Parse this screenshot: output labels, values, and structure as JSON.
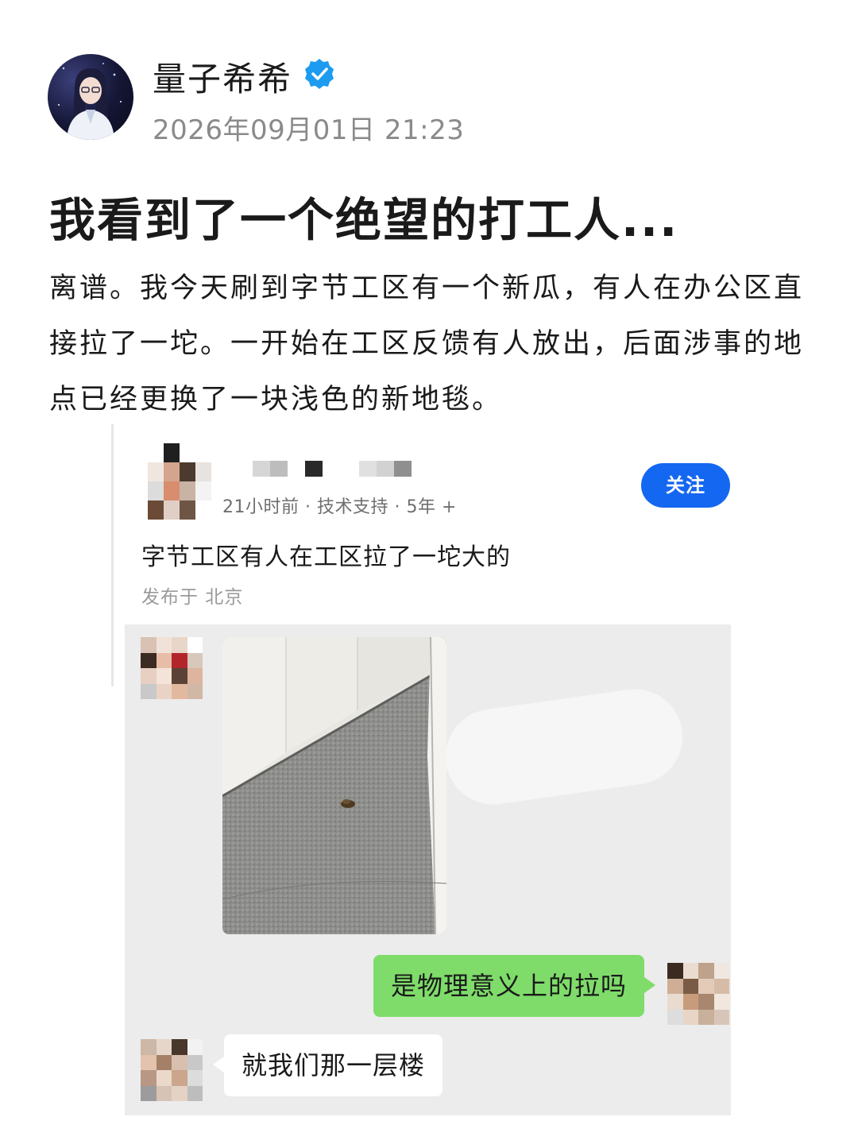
{
  "author": {
    "name": "量子希希",
    "verified": true,
    "timestamp": "2026年09月01日  21:23"
  },
  "post": {
    "title": "我看到了一个绝望的打工人...",
    "body": "离谱。我今天刷到字节工区有一个新瓜，有人在办公区直接拉了一坨。一开始在工区反馈有人放出，后面涉事的地点已经更换了一块浅色的新地毯。"
  },
  "embedded": {
    "meta": "21小时前 · 技术支持 · 5年 +",
    "follow_label": "关注",
    "title": "字节工区有人在工区拉了一坨大的",
    "location": "发布于 北京",
    "chat": {
      "messages": [
        {
          "side": "left",
          "type": "image"
        },
        {
          "side": "right",
          "text": "是物理意义上的拉吗"
        },
        {
          "side": "left",
          "text": "就我们那一层楼"
        }
      ]
    }
  },
  "colors": {
    "follow_button": "#1467f0",
    "verified_badge": "#1d9bf0",
    "bubble_sent": "#7fdc6a",
    "bubble_received": "#ffffff",
    "chat_background": "#ececec"
  },
  "icons": [
    "verified-badge-icon",
    "check-icon"
  ]
}
